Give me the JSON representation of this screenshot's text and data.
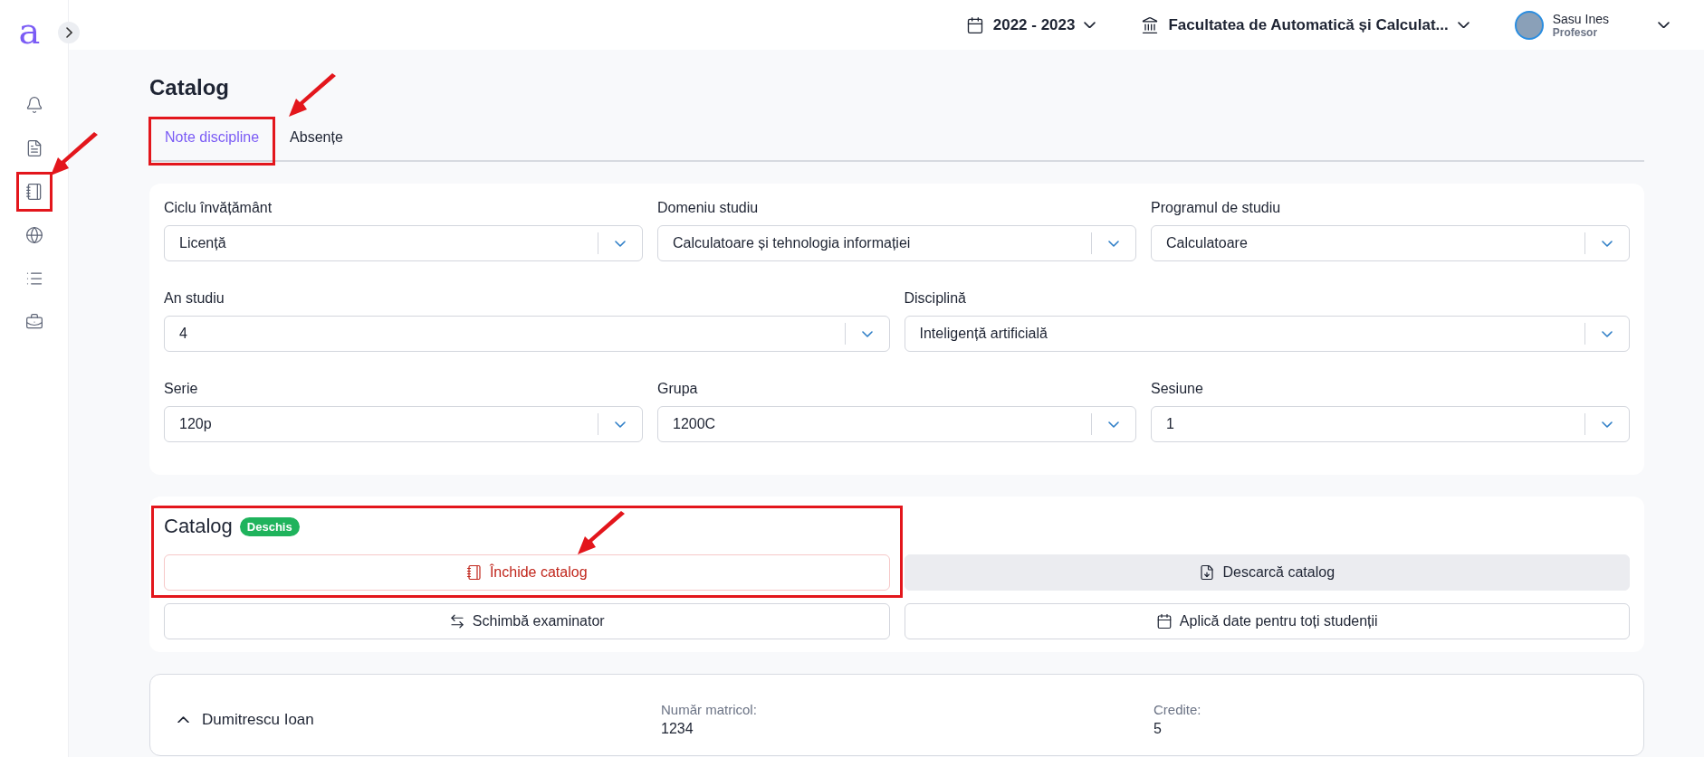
{
  "logo": "a",
  "topbar": {
    "year": "2022 - 2023",
    "faculty": "Facultatea de Automatică și Calculat...",
    "user": {
      "name": "Sasu Ines",
      "role": "Profesor"
    }
  },
  "page_title": "Catalog",
  "tabs": [
    {
      "label": "Note discipline",
      "selected": true
    },
    {
      "label": "Absențe",
      "selected": false
    }
  ],
  "filters": [
    [
      {
        "label": "Ciclu învățământ",
        "value": "Licență"
      },
      {
        "label": "Domeniu studiu",
        "value": "Calculatoare și tehnologia informației"
      },
      {
        "label": "Programul de studiu",
        "value": "Calculatoare"
      }
    ],
    [
      {
        "label": "An studiu",
        "value": "4"
      },
      {
        "label": "Disciplină",
        "value": "Inteligență artificială"
      }
    ],
    [
      {
        "label": "Serie",
        "value": "120p"
      },
      {
        "label": "Grupa",
        "value": "1200C"
      },
      {
        "label": "Sesiune",
        "value": "1"
      }
    ]
  ],
  "catalog": {
    "title": "Catalog",
    "status": "Deschis",
    "buttons": [
      {
        "label": "Închide catalog",
        "kind": "danger"
      },
      {
        "label": "Descarcă catalog",
        "kind": "filled"
      },
      {
        "label": "Schimbă examinator",
        "kind": "outline"
      },
      {
        "label": "Aplică date pentru toți studenții",
        "kind": "outline"
      }
    ]
  },
  "students": [
    {
      "name": "Dumitrescu Ioan",
      "expanded": true,
      "fields": [
        {
          "label": "Număr matricol:",
          "value": "1234"
        },
        {
          "label": "Credite:",
          "value": "5"
        }
      ]
    }
  ]
}
